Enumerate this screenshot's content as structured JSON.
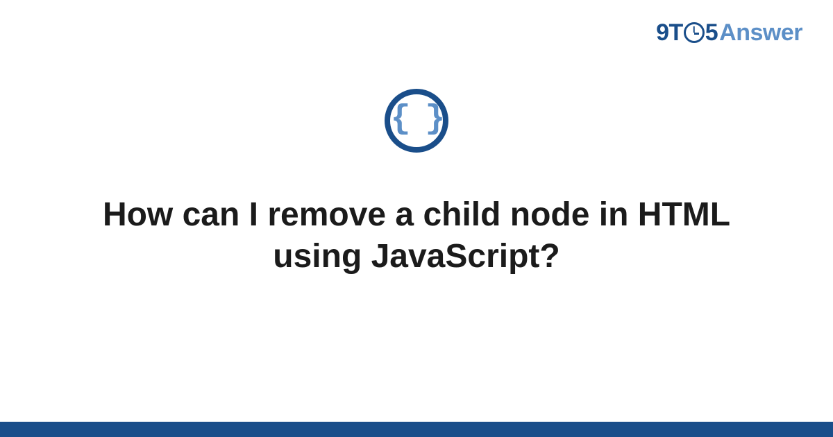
{
  "logo": {
    "part1": "9T",
    "part2": "5",
    "part3": "Answer"
  },
  "badge": {
    "glyph": "{ }"
  },
  "question": {
    "title": "How can I remove a child node in HTML using JavaScript?"
  }
}
